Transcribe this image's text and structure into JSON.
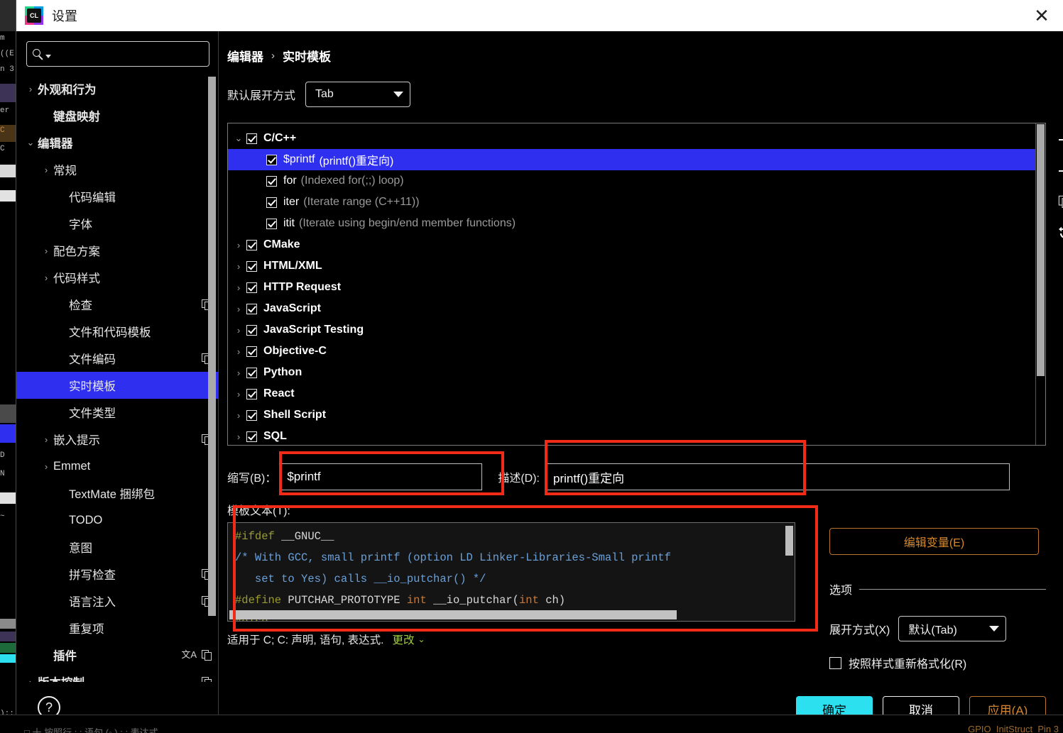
{
  "window": {
    "title": "设置",
    "logo_icon": "clion-logo-icon",
    "close_icon": "close-icon"
  },
  "sidebar": {
    "search": {
      "placeholder": "",
      "value": "",
      "icon": "search-icon",
      "dropdown_icon": "chevron-down-icon"
    },
    "items": [
      {
        "label": "外观和行为",
        "arrow": "›",
        "indent": 0,
        "bold": true,
        "selected": false,
        "copy": false,
        "translate": false
      },
      {
        "label": "键盘映射",
        "arrow": "",
        "indent": 1,
        "bold": true,
        "selected": false,
        "copy": false,
        "translate": false
      },
      {
        "label": "编辑器",
        "arrow": "⌄",
        "indent": 0,
        "bold": true,
        "selected": false,
        "copy": false,
        "translate": false
      },
      {
        "label": "常规",
        "arrow": "›",
        "indent": 1,
        "bold": false,
        "selected": false,
        "copy": false,
        "translate": false
      },
      {
        "label": "代码编辑",
        "arrow": "",
        "indent": 2,
        "bold": false,
        "selected": false,
        "copy": false,
        "translate": false
      },
      {
        "label": "字体",
        "arrow": "",
        "indent": 2,
        "bold": false,
        "selected": false,
        "copy": false,
        "translate": false
      },
      {
        "label": "配色方案",
        "arrow": "›",
        "indent": 1,
        "bold": false,
        "selected": false,
        "copy": false,
        "translate": false
      },
      {
        "label": "代码样式",
        "arrow": "›",
        "indent": 1,
        "bold": false,
        "selected": false,
        "copy": false,
        "translate": false
      },
      {
        "label": "检查",
        "arrow": "",
        "indent": 2,
        "bold": false,
        "selected": false,
        "copy": true,
        "translate": false
      },
      {
        "label": "文件和代码模板",
        "arrow": "",
        "indent": 2,
        "bold": false,
        "selected": false,
        "copy": false,
        "translate": false
      },
      {
        "label": "文件编码",
        "arrow": "",
        "indent": 2,
        "bold": false,
        "selected": false,
        "copy": true,
        "translate": false
      },
      {
        "label": "实时模板",
        "arrow": "",
        "indent": 2,
        "bold": false,
        "selected": true,
        "copy": false,
        "translate": false
      },
      {
        "label": "文件类型",
        "arrow": "",
        "indent": 2,
        "bold": false,
        "selected": false,
        "copy": false,
        "translate": false
      },
      {
        "label": "嵌入提示",
        "arrow": "›",
        "indent": 1,
        "bold": false,
        "selected": false,
        "copy": true,
        "translate": false
      },
      {
        "label": "Emmet",
        "arrow": "›",
        "indent": 1,
        "bold": false,
        "selected": false,
        "copy": false,
        "translate": false
      },
      {
        "label": "TextMate 捆绑包",
        "arrow": "",
        "indent": 2,
        "bold": false,
        "selected": false,
        "copy": false,
        "translate": false
      },
      {
        "label": "TODO",
        "arrow": "",
        "indent": 2,
        "bold": false,
        "selected": false,
        "copy": false,
        "translate": false
      },
      {
        "label": "意图",
        "arrow": "",
        "indent": 2,
        "bold": false,
        "selected": false,
        "copy": false,
        "translate": false
      },
      {
        "label": "拼写检查",
        "arrow": "",
        "indent": 2,
        "bold": false,
        "selected": false,
        "copy": true,
        "translate": false
      },
      {
        "label": "语言注入",
        "arrow": "",
        "indent": 2,
        "bold": false,
        "selected": false,
        "copy": true,
        "translate": false
      },
      {
        "label": "重复项",
        "arrow": "",
        "indent": 2,
        "bold": false,
        "selected": false,
        "copy": false,
        "translate": false
      },
      {
        "label": "插件",
        "arrow": "",
        "indent": 1,
        "bold": true,
        "selected": false,
        "copy": true,
        "translate": true
      },
      {
        "label": "版本控制",
        "arrow": "›",
        "indent": 0,
        "bold": true,
        "selected": false,
        "copy": true,
        "translate": false
      }
    ],
    "help_button": {
      "label": "?",
      "icon": "help-icon"
    }
  },
  "content": {
    "breadcrumb": {
      "parent": "编辑器",
      "separator": "›",
      "current": "实时模板"
    },
    "expand_with": {
      "label": "默认展开方式",
      "value": "Tab",
      "dropdown_icon": "chevron-down-icon"
    },
    "templates": [
      {
        "indent": 0,
        "arrow": "⌄",
        "checked": true,
        "name": "C/C++",
        "desc": "",
        "group": true,
        "selected": false
      },
      {
        "indent": 1,
        "arrow": "",
        "checked": true,
        "name": "$printf",
        "desc": "(printf()重定向)",
        "group": false,
        "selected": true
      },
      {
        "indent": 1,
        "arrow": "",
        "checked": true,
        "name": "for",
        "desc": "(Indexed for(;;) loop)",
        "group": false,
        "selected": false
      },
      {
        "indent": 1,
        "arrow": "",
        "checked": true,
        "name": "iter",
        "desc": "(Iterate range (C++11))",
        "group": false,
        "selected": false
      },
      {
        "indent": 1,
        "arrow": "",
        "checked": true,
        "name": "itit",
        "desc": "(Iterate using begin/end member functions)",
        "group": false,
        "selected": false
      },
      {
        "indent": 0,
        "arrow": "›",
        "checked": true,
        "name": "CMake",
        "desc": "",
        "group": true,
        "selected": false
      },
      {
        "indent": 0,
        "arrow": "›",
        "checked": true,
        "name": "HTML/XML",
        "desc": "",
        "group": true,
        "selected": false
      },
      {
        "indent": 0,
        "arrow": "›",
        "checked": true,
        "name": "HTTP Request",
        "desc": "",
        "group": true,
        "selected": false
      },
      {
        "indent": 0,
        "arrow": "›",
        "checked": true,
        "name": "JavaScript",
        "desc": "",
        "group": true,
        "selected": false
      },
      {
        "indent": 0,
        "arrow": "›",
        "checked": true,
        "name": "JavaScript Testing",
        "desc": "",
        "group": true,
        "selected": false
      },
      {
        "indent": 0,
        "arrow": "›",
        "checked": true,
        "name": "Objective-C",
        "desc": "",
        "group": true,
        "selected": false
      },
      {
        "indent": 0,
        "arrow": "›",
        "checked": true,
        "name": "Python",
        "desc": "",
        "group": true,
        "selected": false
      },
      {
        "indent": 0,
        "arrow": "›",
        "checked": true,
        "name": "React",
        "desc": "",
        "group": true,
        "selected": false
      },
      {
        "indent": 0,
        "arrow": "›",
        "checked": true,
        "name": "Shell Script",
        "desc": "",
        "group": true,
        "selected": false
      },
      {
        "indent": 0,
        "arrow": "›",
        "checked": true,
        "name": "SQL",
        "desc": "",
        "group": true,
        "selected": false
      }
    ],
    "toolbar": {
      "add": "add-icon",
      "remove": "remove-icon",
      "duplicate": "duplicate-icon",
      "revert": "revert-icon"
    },
    "abbreviation": {
      "label": "缩写(B)：",
      "value": "$printf"
    },
    "description": {
      "label": "描述(D):",
      "value": "printf()重定向"
    },
    "template_text": {
      "label": "模板文本(T):",
      "lines": [
        [
          {
            "t": "#ifdef",
            "c": "prep"
          },
          {
            "t": " __GNUC__",
            "c": "txt"
          }
        ],
        [
          {
            "t": "/* With GCC, small printf (option LD Linker-Libraries-Small printf",
            "c": "cmt"
          }
        ],
        [
          {
            "t": "   set to Yes) calls __io_putchar() */",
            "c": "cmt"
          }
        ],
        [
          {
            "t": "#define",
            "c": "prep"
          },
          {
            "t": " PUTCHAR_PROTOTYPE ",
            "c": "txt"
          },
          {
            "t": "int",
            "c": "kw"
          },
          {
            "t": " __io_putchar(",
            "c": "txt"
          },
          {
            "t": "int",
            "c": "kw"
          },
          {
            "t": " ch)",
            "c": "txt"
          }
        ],
        [
          {
            "t": "#else",
            "c": "prep"
          }
        ]
      ]
    },
    "applies_to": {
      "text": "适用于 C; C: 声明, 语句, 表达式.",
      "change_label": "更改",
      "change_icon": "chevron-down-icon"
    },
    "edit_variables_button": "编辑变量(E)",
    "options": {
      "title": "选项",
      "expand_with": {
        "label": "展开方式(X)",
        "value": "默认(Tab)",
        "dropdown_icon": "chevron-down-icon"
      },
      "reformat": {
        "label": "按照样式重新格式化(R)",
        "checked": false
      }
    }
  },
  "footer": {
    "ok": "确定",
    "cancel": "取消",
    "apply": "应用(A)"
  },
  "colors": {
    "selection_blue": "#2f2ff0",
    "accent_cyan": "#2ce0f0",
    "accent_orange": "#d4872f",
    "annotation_red": "#f22a18",
    "keyword_orange": "#cc7832",
    "comment_blue": "#6aa0d8",
    "preproc_olive": "#9a9a32",
    "change_green": "#9ecb3c"
  },
  "background": {
    "bottom_left_text": "□ 十 按照行 ; ; 语句 (◦ )  ; ; 表达式",
    "bottom_right_text": "GPIO_InitStruct_Pin 3"
  }
}
